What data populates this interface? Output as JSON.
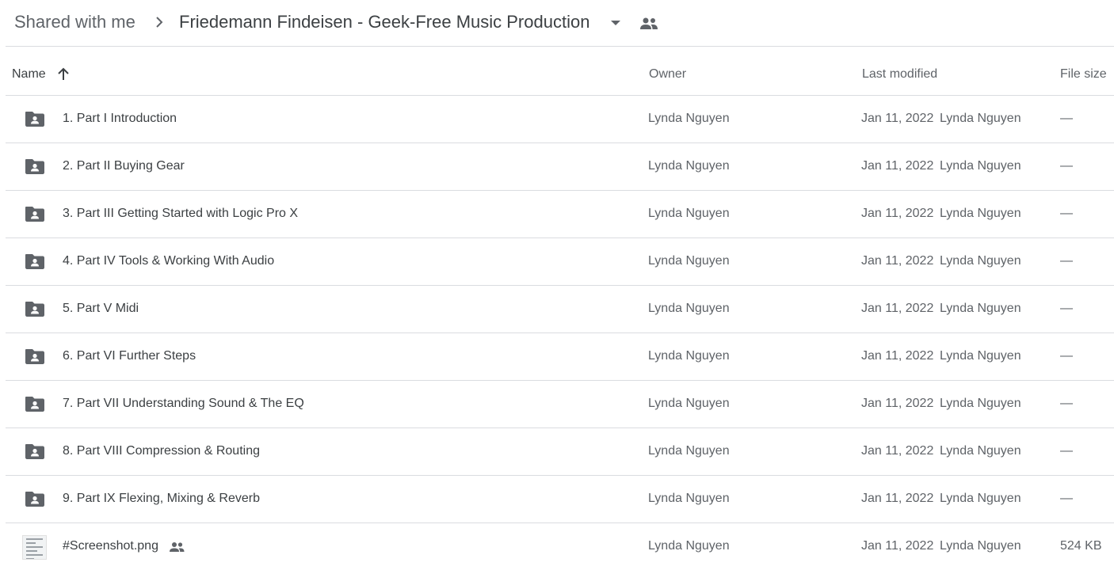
{
  "breadcrumb": {
    "root": "Shared with me",
    "current": "Friedemann Findeisen - Geek-Free Music Production",
    "separator_icon": "chevron-right-icon",
    "dropdown_icon": "caret-down-icon",
    "shared_icon": "people-icon"
  },
  "columns": {
    "name": "Name",
    "owner": "Owner",
    "last_modified": "Last modified",
    "file_size": "File size",
    "sort_icon": "arrow-up-icon"
  },
  "files": [
    {
      "name": "1. Part I Introduction",
      "type": "shared-folder",
      "owner": "Lynda Nguyen",
      "modified": "Jan 11, 2022",
      "modified_by": "Lynda Nguyen",
      "size": "—"
    },
    {
      "name": "2. Part II Buying Gear",
      "type": "shared-folder",
      "owner": "Lynda Nguyen",
      "modified": "Jan 11, 2022",
      "modified_by": "Lynda Nguyen",
      "size": "—"
    },
    {
      "name": "3. Part III Getting Started with Logic Pro X",
      "type": "shared-folder",
      "owner": "Lynda Nguyen",
      "modified": "Jan 11, 2022",
      "modified_by": "Lynda Nguyen",
      "size": "—"
    },
    {
      "name": "4. Part IV Tools & Working With Audio",
      "type": "shared-folder",
      "owner": "Lynda Nguyen",
      "modified": "Jan 11, 2022",
      "modified_by": "Lynda Nguyen",
      "size": "—"
    },
    {
      "name": "5. Part V Midi",
      "type": "shared-folder",
      "owner": "Lynda Nguyen",
      "modified": "Jan 11, 2022",
      "modified_by": "Lynda Nguyen",
      "size": "—"
    },
    {
      "name": "6. Part VI Further Steps",
      "type": "shared-folder",
      "owner": "Lynda Nguyen",
      "modified": "Jan 11, 2022",
      "modified_by": "Lynda Nguyen",
      "size": "—"
    },
    {
      "name": "7. Part VII Understanding Sound & The EQ",
      "type": "shared-folder",
      "owner": "Lynda Nguyen",
      "modified": "Jan 11, 2022",
      "modified_by": "Lynda Nguyen",
      "size": "—"
    },
    {
      "name": "8. Part VIII Compression & Routing",
      "type": "shared-folder",
      "owner": "Lynda Nguyen",
      "modified": "Jan 11, 2022",
      "modified_by": "Lynda Nguyen",
      "size": "—"
    },
    {
      "name": "9. Part IX Flexing, Mixing & Reverb",
      "type": "shared-folder",
      "owner": "Lynda Nguyen",
      "modified": "Jan 11, 2022",
      "modified_by": "Lynda Nguyen",
      "size": "—"
    },
    {
      "name": "#Screenshot.png",
      "type": "image",
      "shared": true,
      "owner": "Lynda Nguyen",
      "modified": "Jan 11, 2022",
      "modified_by": "Lynda Nguyen",
      "size": "524 KB"
    }
  ],
  "colors": {
    "text_primary": "#3c4043",
    "text_secondary": "#5f6368",
    "divider": "#dadce0",
    "icon": "#5f6368"
  }
}
